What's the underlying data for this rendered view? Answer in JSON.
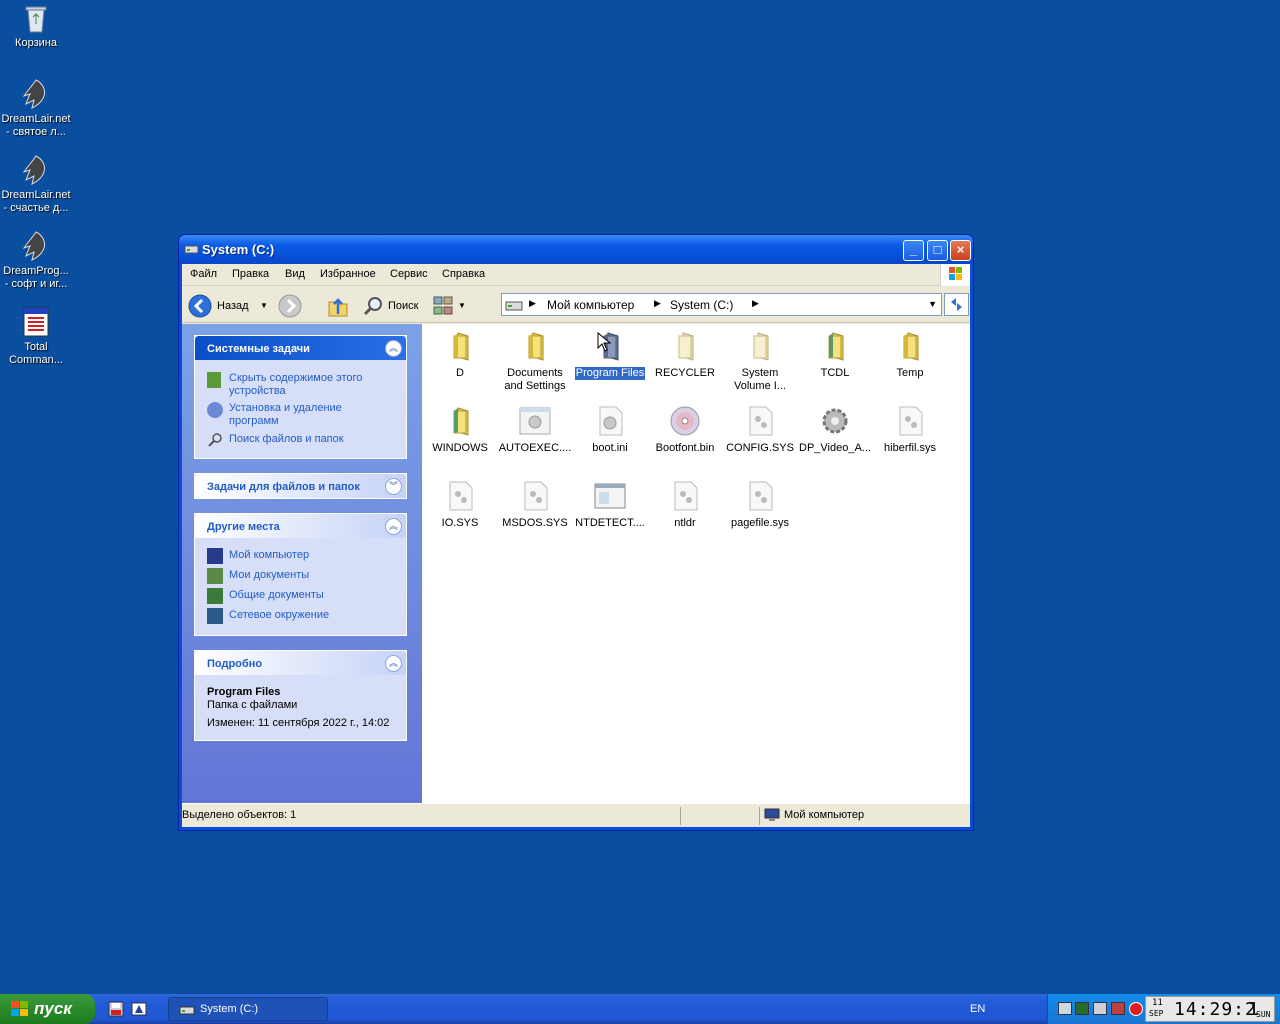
{
  "desktop": {
    "icons": [
      {
        "label": "Корзина",
        "icon": "recycle-bin-icon"
      },
      {
        "label": "DreamLair.net\n- святое л...",
        "icon": "dreamlair-icon"
      },
      {
        "label": "DreamLair.net\n- счастье д...",
        "icon": "dreamlair-icon"
      },
      {
        "label": "DreamProg...\n- софт и иг...",
        "icon": "dreamprog-icon"
      },
      {
        "label": "Total\nComman...",
        "icon": "total-commander-icon"
      }
    ]
  },
  "window": {
    "title": "System (C:)",
    "menu": [
      "Файл",
      "Правка",
      "Вид",
      "Избранное",
      "Сервис",
      "Справка"
    ],
    "toolbar": {
      "back_label": "Назад",
      "search_label": "Поиск"
    },
    "address": {
      "crumbs": [
        "Мой компьютер",
        "System (C:)"
      ]
    },
    "sidebar": {
      "system_tasks": {
        "title": "Системные задачи",
        "items": [
          "Скрыть содержимое этого устройства",
          "Установка и удаление программ",
          "Поиск файлов и папок"
        ]
      },
      "file_tasks": {
        "title": "Задачи для файлов и папок"
      },
      "other_places": {
        "title": "Другие места",
        "items": [
          "Мой компьютер",
          "Мои документы",
          "Общие документы",
          "Сетевое окружение"
        ]
      },
      "details": {
        "title": "Подробно",
        "name": "Program Files",
        "type": "Папка с файлами",
        "modified": "Изменен: 11 сентября 2022 г., 14:02"
      }
    },
    "files": [
      {
        "label": "D",
        "icon": "folder-icon"
      },
      {
        "label": "Documents\nand Settings",
        "icon": "folder-icon"
      },
      {
        "label": "Program Files",
        "icon": "folder-icon",
        "selected": true
      },
      {
        "label": "RECYCLER",
        "icon": "folder-icon"
      },
      {
        "label": "System\nVolume I...",
        "icon": "folder-icon"
      },
      {
        "label": "TCDL",
        "icon": "folder-icon"
      },
      {
        "label": "Temp",
        "icon": "folder-icon"
      },
      {
        "label": "WINDOWS",
        "icon": "folder-icon"
      },
      {
        "label": "AUTOEXEC....",
        "icon": "system-file-icon"
      },
      {
        "label": "boot.ini",
        "icon": "settings-file-icon"
      },
      {
        "label": "Bootfont.bin",
        "icon": "cd-icon"
      },
      {
        "label": "CONFIG.SYS",
        "icon": "system-file-icon"
      },
      {
        "label": "DP_Video_A...",
        "icon": "settings-file-icon"
      },
      {
        "label": "hiberfil.sys",
        "icon": "system-file-icon"
      },
      {
        "label": "IO.SYS",
        "icon": "system-file-icon"
      },
      {
        "label": "MSDOS.SYS",
        "icon": "system-file-icon"
      },
      {
        "label": "NTDETECT....",
        "icon": "application-icon"
      },
      {
        "label": "ntldr",
        "icon": "system-file-icon"
      },
      {
        "label": "pagefile.sys",
        "icon": "system-file-icon"
      }
    ],
    "status": {
      "selection": "Выделено объектов: 1",
      "location": "Мой компьютер"
    }
  },
  "taskbar": {
    "start_label": "пуск",
    "task_label": "System (C:)",
    "lang": "EN",
    "clock": {
      "day": "11",
      "month": "SEP",
      "time": "14:29:2",
      "seconds": "1",
      "weekday": "SUN"
    }
  },
  "colors": {
    "desktop": "#0a4f9f",
    "titlebar": "#0b5ae6",
    "selection": "#316ac5",
    "link": "#215dc6"
  }
}
